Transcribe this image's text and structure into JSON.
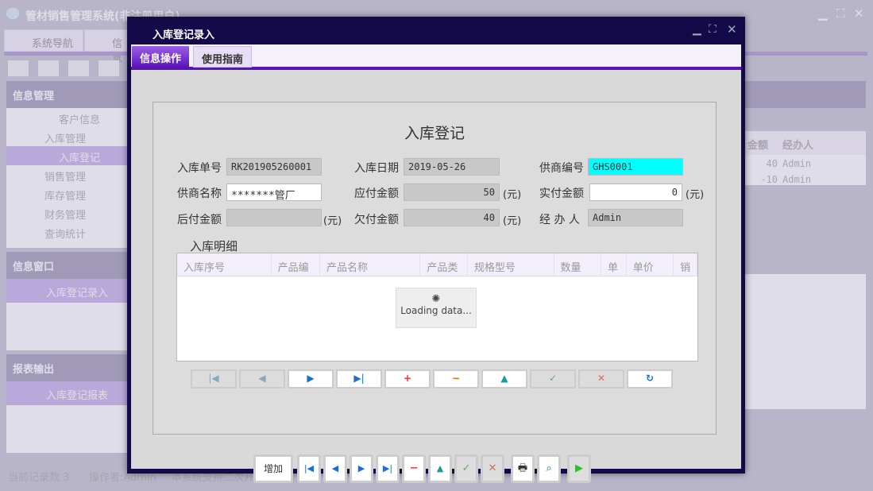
{
  "app": {
    "title": "管材销售管理系统(非注册用户)",
    "tabs": [
      "系统导航",
      "信息"
    ],
    "left": {
      "info_mgmt": "信息管理",
      "tree": [
        "客户信息",
        "入库管理",
        "入库登记",
        "销售管理",
        "库存管理",
        "财务管理",
        "查询统计"
      ],
      "info_window": "信息窗口",
      "info_window_item": "入库登记录入",
      "report": "报表输出",
      "report_item": "入库登记报表"
    },
    "right": {
      "headers": [
        "金额",
        "经办人"
      ],
      "rows": [
        [
          "40",
          "Admin"
        ],
        [
          "-10",
          "Admin"
        ]
      ]
    },
    "status": {
      "count": "当前记录数 3",
      "operator": "操作者:Admin",
      "note": "本系统支持二次开发和全新开发!"
    }
  },
  "dialog": {
    "title": "入库登记录入",
    "tabs": [
      "信息操作",
      "使用指南"
    ],
    "form": {
      "title": "入库登记",
      "f": {
        "in_no_label": "入库单号",
        "in_no": "RK201905260001",
        "in_date_label": "入库日期",
        "in_date": "2019-05-26",
        "sup_no_label": "供商编号",
        "sup_no": "GHS0001",
        "sup_name_label": "供商名称",
        "sup_name": "*******管厂",
        "payable_label": "应付金额",
        "payable": "50",
        "paid_label": "实付金额",
        "paid": "0",
        "later_label": "后付金额",
        "later": "",
        "owed_label": "欠付金额",
        "owed": "40",
        "handler_label": "经 办 人",
        "handler": "Admin",
        "unit": "(元)"
      },
      "detail_label": "入库明细",
      "columns": [
        "入库序号",
        "产品编",
        "产品名称",
        "产品类",
        "规格型号",
        "数量",
        "单",
        "单价",
        "销"
      ],
      "loading": "Loading data..."
    },
    "add_label": "增加"
  },
  "colors": {
    "dialog": "#140a4a",
    "accent": "#5b12b8",
    "highlight": "#00ffff"
  }
}
